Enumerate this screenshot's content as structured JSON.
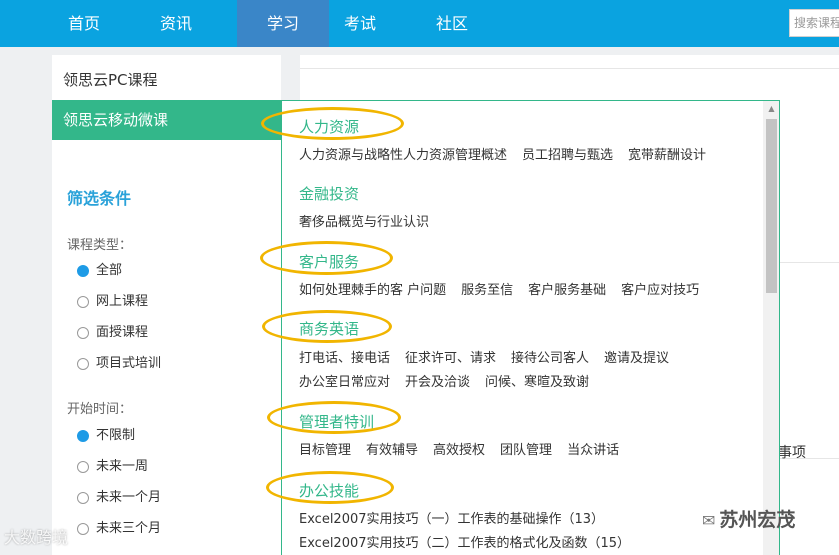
{
  "nav": {
    "items": [
      "首页",
      "资讯",
      "学习",
      "考试",
      "社区"
    ],
    "active_index": 2,
    "search_placeholder": "搜索课程"
  },
  "sidebar": {
    "links": [
      "领思云PC课程",
      "领思云移动微课"
    ],
    "active_link_index": 1,
    "filter_title": "筛选条件",
    "groups": [
      {
        "label": "课程类型：",
        "options": [
          "全部",
          "网上课程",
          "面授课程",
          "项目式培训"
        ],
        "checked_index": 0
      },
      {
        "label": "开始时间：",
        "options": [
          "不限制",
          "未来一周",
          "未来一个月",
          "未来三个月"
        ],
        "checked_index": 0
      }
    ]
  },
  "background_text": "事项",
  "dropdown": {
    "categories": [
      {
        "name": "人力资源",
        "highlighted": true,
        "lines": [
          [
            "人力资源与战略性人力资源管理概述",
            "员工招聘与甄选",
            "宽带薪酬设计"
          ]
        ]
      },
      {
        "name": "金融投资",
        "highlighted": false,
        "lines": [
          [
            "奢侈品概览与行业认识"
          ]
        ]
      },
      {
        "name": "客户服务",
        "highlighted": true,
        "lines": [
          [
            "如何处理棘手的客 户问题",
            "服务至信",
            "客户服务基础",
            "客户应对技巧"
          ]
        ]
      },
      {
        "name": "商务英语",
        "highlighted": true,
        "lines": [
          [
            "打电话、接电话",
            "征求许可、请求",
            "接待公司客人",
            "邀请及提议"
          ],
          [
            "办公室日常应对",
            "开会及洽谈",
            "问候、寒暄及致谢"
          ]
        ]
      },
      {
        "name": "管理者特训",
        "highlighted": true,
        "lines": [
          [
            "目标管理",
            "有效辅导",
            "高效授权",
            "团队管理",
            "当众讲话"
          ]
        ]
      },
      {
        "name": "办公技能",
        "highlighted": true,
        "lines": [
          [
            "Excel2007实用技巧（一）工作表的基础操作（13）"
          ],
          [
            "Excel2007实用技巧（二）工作表的格式化及函数（15）"
          ]
        ]
      }
    ]
  },
  "colors": {
    "nav_bg": "#0aa3e0",
    "nav_active": "#3a86c8",
    "accent_green": "#33b78a",
    "filter_blue": "#2aa2d9",
    "highlight_ring": "#f1b500"
  },
  "watermarks": {
    "left": "大数跨境",
    "right": "苏州宏茂",
    "right_icon": "wechat-icon"
  }
}
